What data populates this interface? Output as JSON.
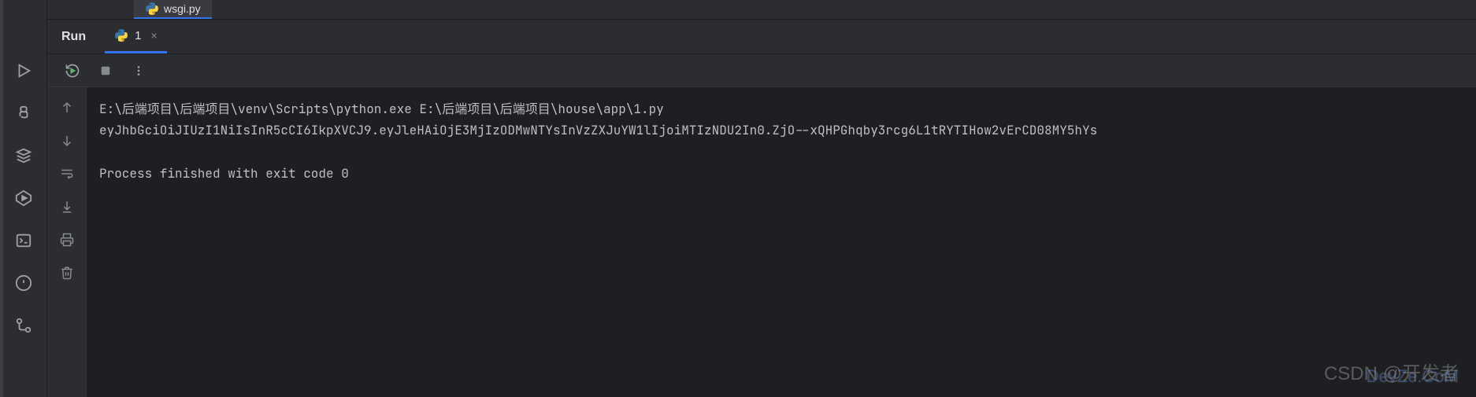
{
  "file_tab": {
    "name": "wsgi.py"
  },
  "run": {
    "label": "Run",
    "tab_label": "1"
  },
  "console": {
    "line1": "E:\\后端项目\\后端项目\\venv\\Scripts\\python.exe E:\\后端项目\\后端项目\\house\\app\\1.py",
    "line2": "eyJhbGciOiJIUzI1NiIsInR5cCI6IkpXVCJ9.eyJleHAiOjE3MjIzODMwNTYsInVzZXJuYW1lIjoiMTIzNDU2In0.ZjO--xQHPGhqby3rcg6L1tRYTIHow2vErCD08MY5hYs",
    "line3": "",
    "line4": "Process finished with exit code 0"
  },
  "watermark": {
    "csdn": "CSDN @",
    "chinese": "开发者",
    "devze": "DevZe.CoM"
  }
}
